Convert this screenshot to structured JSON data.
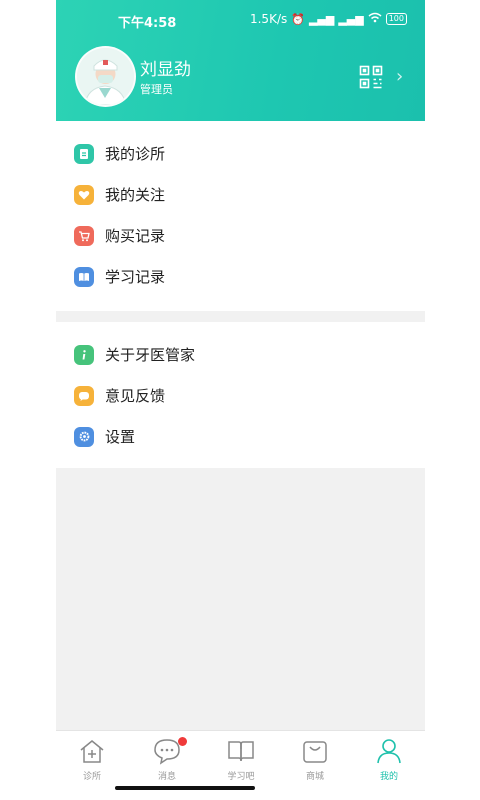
{
  "status_bar": {
    "time": "下午4:58",
    "network_speed": "1.5K/s",
    "battery": "100"
  },
  "profile": {
    "name": "刘显劲",
    "role": "管理员"
  },
  "menu_group_1": [
    {
      "label": "我的诊所",
      "icon": "clinic-icon",
      "color": "#2fc6a8"
    },
    {
      "label": "我的关注",
      "icon": "heart-icon",
      "color": "#f6b23a"
    },
    {
      "label": "购买记录",
      "icon": "cart-icon",
      "color": "#ef6a5b"
    },
    {
      "label": "学习记录",
      "icon": "book-icon",
      "color": "#4f8fe0"
    }
  ],
  "menu_group_2": [
    {
      "label": "关于牙医管家",
      "icon": "info-icon",
      "color": "#46c37b"
    },
    {
      "label": "意见反馈",
      "icon": "feedback-icon",
      "color": "#f6b23a"
    },
    {
      "label": "设置",
      "icon": "settings-icon",
      "color": "#4f8fe0"
    }
  ],
  "tabbar": [
    {
      "label": "诊所",
      "icon": "home-plus-icon",
      "active": false
    },
    {
      "label": "消息",
      "icon": "message-icon",
      "active": false
    },
    {
      "label": "学习吧",
      "icon": "open-book-icon",
      "active": false
    },
    {
      "label": "商城",
      "icon": "shopping-bag-icon",
      "active": false
    },
    {
      "label": "我的",
      "icon": "user-icon",
      "active": true
    }
  ],
  "accent_color": "#1fc1ac"
}
